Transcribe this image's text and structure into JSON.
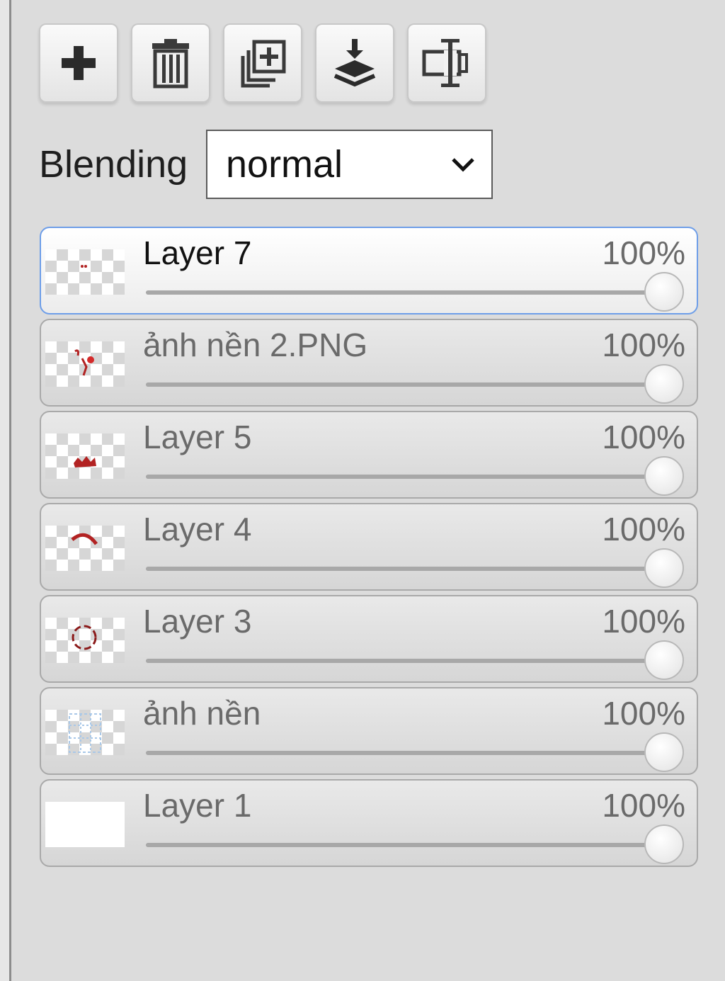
{
  "toolbar": {
    "buttons": [
      {
        "name": "add-layer-button",
        "icon": "plus-icon"
      },
      {
        "name": "delete-layer-button",
        "icon": "trash-icon"
      },
      {
        "name": "duplicate-layer-button",
        "icon": "duplicate-icon"
      },
      {
        "name": "merge-down-button",
        "icon": "merge-down-icon"
      },
      {
        "name": "rename-layer-button",
        "icon": "rename-icon"
      }
    ]
  },
  "blending": {
    "label": "Blending",
    "selected": "normal"
  },
  "layers": [
    {
      "name": "Layer 7",
      "opacity": "100%",
      "opacity_value": 1.0,
      "active": true
    },
    {
      "name": "ảnh nền 2.PNG",
      "opacity": "100%",
      "opacity_value": 1.0,
      "active": false
    },
    {
      "name": "Layer 5",
      "opacity": "100%",
      "opacity_value": 1.0,
      "active": false
    },
    {
      "name": "Layer 4",
      "opacity": "100%",
      "opacity_value": 1.0,
      "active": false
    },
    {
      "name": "Layer 3",
      "opacity": "100%",
      "opacity_value": 1.0,
      "active": false
    },
    {
      "name": "ảnh nền",
      "opacity": "100%",
      "opacity_value": 1.0,
      "active": false
    },
    {
      "name": "Layer 1",
      "opacity": "100%",
      "opacity_value": 1.0,
      "active": false
    }
  ],
  "colors": {
    "active_border": "#6e9ee8",
    "thumb_stroke": "#b22222"
  }
}
